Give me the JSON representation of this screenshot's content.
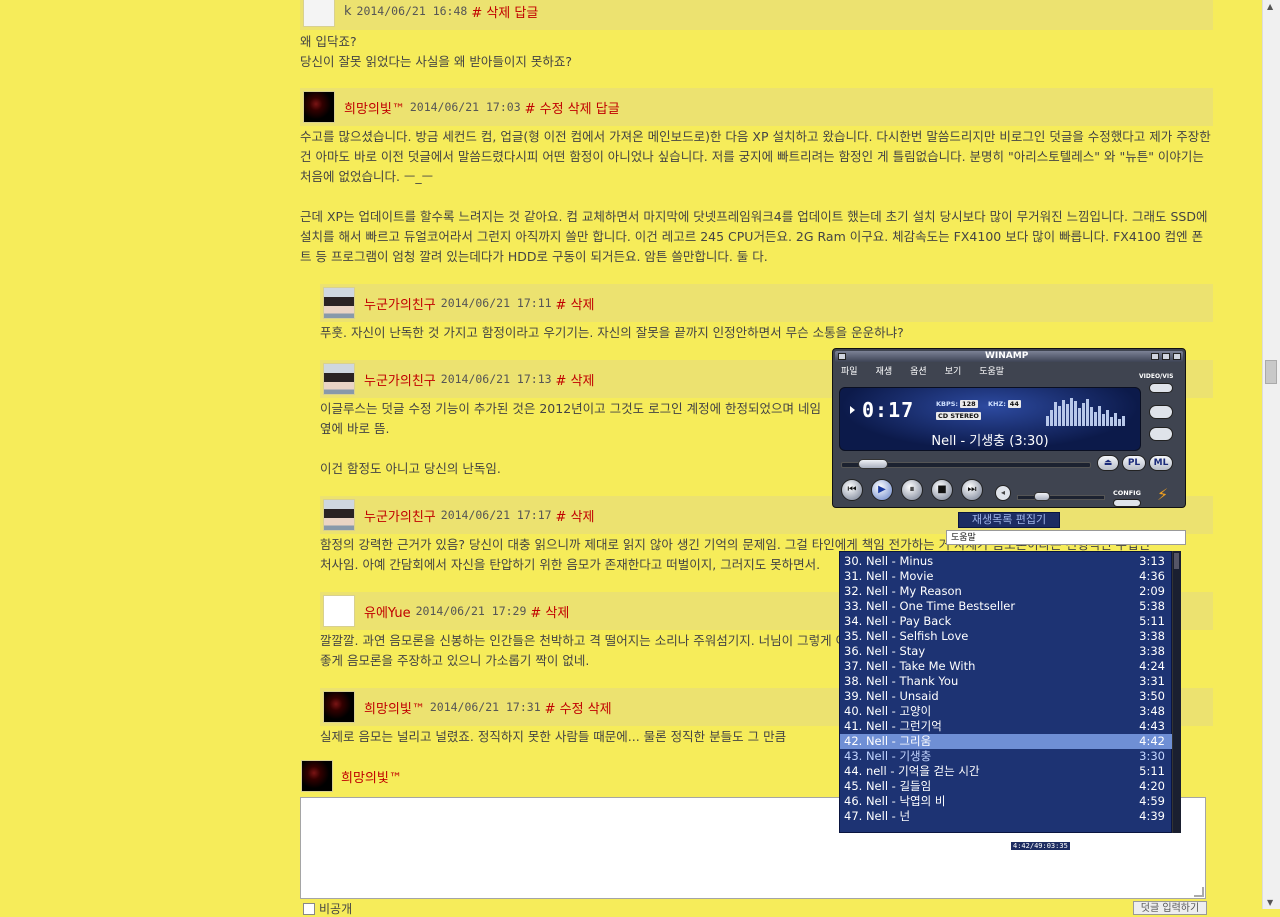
{
  "comments": [
    {
      "name": "k",
      "date": "2014/06/21 16:48",
      "actions": "# 삭제 답글",
      "body": "왜 입닥죠?\n당신이 잘못 읽었다는 사실을 왜 받아들이지 못하죠?"
    },
    {
      "name": "희망의빛™",
      "date": "2014/06/21 17:03",
      "actions": "# 수정 삭제 답글",
      "body": "수고를 많으셨습니다. 방금 세컨드 컴, 업글(형 이전 컴에서 가져온 메인보드로)한 다음 XP 설치하고 왔습니다. 다시한번 말씀드리지만 비로그인 덧글을 수정했다고 제가 주장한 건 아마도 바로 이전 덧글에서 말씀드렸다시피 어떤 함정이 아니었나 싶습니다. 저를 궁지에 빠트리려는 함정인 게 틀림없습니다. 분명히 \"아리스토텔레스\" 와 \"뉴튼\" 이야기는 처음에 없었습니다. ㅡ_ㅡ\n\n근데 XP는 업데이트를 할수록 느려지는 것 같아요. 컴 교체하면서 마지막에 닷넷프레임워크4를 업데이트 했는데 초기 설치 당시보다 많이 무거워진 느낌입니다. 그래도 SSD에 설치를 해서 빠르고 듀얼코어라서 그런지 아직까지 쓸만 합니다. 이건 레고르 245 CPU거든요. 2G Ram 이구요. 체감속도는 FX4100 보다 많이 빠릅니다. FX4100 컴엔 폰트 등 프로그램이 엄청 깔려 있는데다가 HDD로 구동이 되거든요. 암튼 쓸만합니다. 둘 다."
    },
    {
      "name": "누군가의친구",
      "date": "2014/06/21 17:11",
      "actions": "# 삭제",
      "body": "푸훗. 자신이 난독한 것 가지고 함정이라고 우기기는. 자신의 잘못을 끝까지 인정안하면서 무슨 소통을 운운하냐?"
    },
    {
      "name": "누군가의친구",
      "date": "2014/06/21 17:13",
      "actions": "# 삭제",
      "body": "이글루스는 덧글 수정 기능이 추가된 것은 2012년이고 그것도 로그인 계정에 한정되었으며 네임\n옆에 바로 뜸.\n\n이건 함정도 아니고 당신의 난독임."
    },
    {
      "name": "누군가의친구",
      "date": "2014/06/21 17:17",
      "actions": "# 삭제",
      "body": "함정의 강력한 근거가 있음? 당신이 대충 읽으니까 제대로 읽지 않아 생긴 기억의 문제임. 그걸 타인에게 책임 전가하는 거 자체가 음모론이라는 전형적인 수법인\n처사임. 아예 간담회에서 자신을 탄압하기 위한 음모가 존재한다고 떠벌이지, 그러지도 못하면서."
    },
    {
      "name": "유에Yue",
      "date": "2014/06/21 17:29",
      "actions": "# 삭제",
      "body": "깔깔깔. 과연 음모론을 신봉하는 인간들은 천박하고 격 떨어지는 소리나 주워섬기지. 너님이 그렇게 어째서\n좋게 음모론을 주장하고 있으니 가소롭기 짝이 없네."
    },
    {
      "name": "희망의빛™",
      "date": "2014/06/21 17:31",
      "actions": "# 수정 삭제",
      "body": "실제로 음모는 널리고 널렸죠. 정직하지 못한 사람들 때문에... 물론 정직한 분들도 그 만큼"
    }
  ],
  "post_form": {
    "name": "희망의빛™",
    "checkbox_label": "비공개",
    "submit_label": "덧글 입력하기"
  },
  "winamp": {
    "title": "WINAMP",
    "menu": [
      "파일",
      "재생",
      "옵션",
      "보기",
      "도움말"
    ],
    "time": "0:17",
    "kbps_label": "KBPS:",
    "kbps": "128",
    "khz_label": "KHZ:",
    "khz": "44",
    "stereo": "CD STEREO",
    "song": "Nell - 기생충 (3:30)",
    "video_vis": "VIDEO/VIS",
    "pl_btn": "PL",
    "ml_btn": "ML",
    "config": "CONFIG",
    "eject": "⏏"
  },
  "playlist": {
    "title": "재생목록 편집기",
    "menu": "도움말",
    "status": "4:42/49:03:35",
    "selected_index": 12,
    "current_index": 13,
    "items": [
      {
        "title": "30. Nell - Minus",
        "dur": "3:13"
      },
      {
        "title": "31. Nell - Movie",
        "dur": "4:36"
      },
      {
        "title": "32. Nell - My Reason",
        "dur": "2:09"
      },
      {
        "title": "33. Nell - One Time Bestseller",
        "dur": "5:38"
      },
      {
        "title": "34. Nell - Pay Back",
        "dur": "5:11"
      },
      {
        "title": "35. Nell - Selfish Love",
        "dur": "3:38"
      },
      {
        "title": "36. Nell - Stay",
        "dur": "3:38"
      },
      {
        "title": "37. Nell - Take Me With",
        "dur": "4:24"
      },
      {
        "title": "38. Nell - Thank You",
        "dur": "3:31"
      },
      {
        "title": "39. Nell - Unsaid",
        "dur": "3:50"
      },
      {
        "title": "40. Nell - 고양이",
        "dur": "3:48"
      },
      {
        "title": "41. Nell - 그런기억",
        "dur": "4:43"
      },
      {
        "title": "42. Nell - 그리움",
        "dur": "4:42"
      },
      {
        "title": "43. Nell - 기생충",
        "dur": "3:30"
      },
      {
        "title": "44. nell - 기억을 걷는 시간",
        "dur": "5:11"
      },
      {
        "title": "45. Nell - 길들임",
        "dur": "4:20"
      },
      {
        "title": "46. Nell - 낙엽의 비",
        "dur": "4:59"
      },
      {
        "title": "47. Nell - 넌",
        "dur": "4:39"
      }
    ]
  }
}
